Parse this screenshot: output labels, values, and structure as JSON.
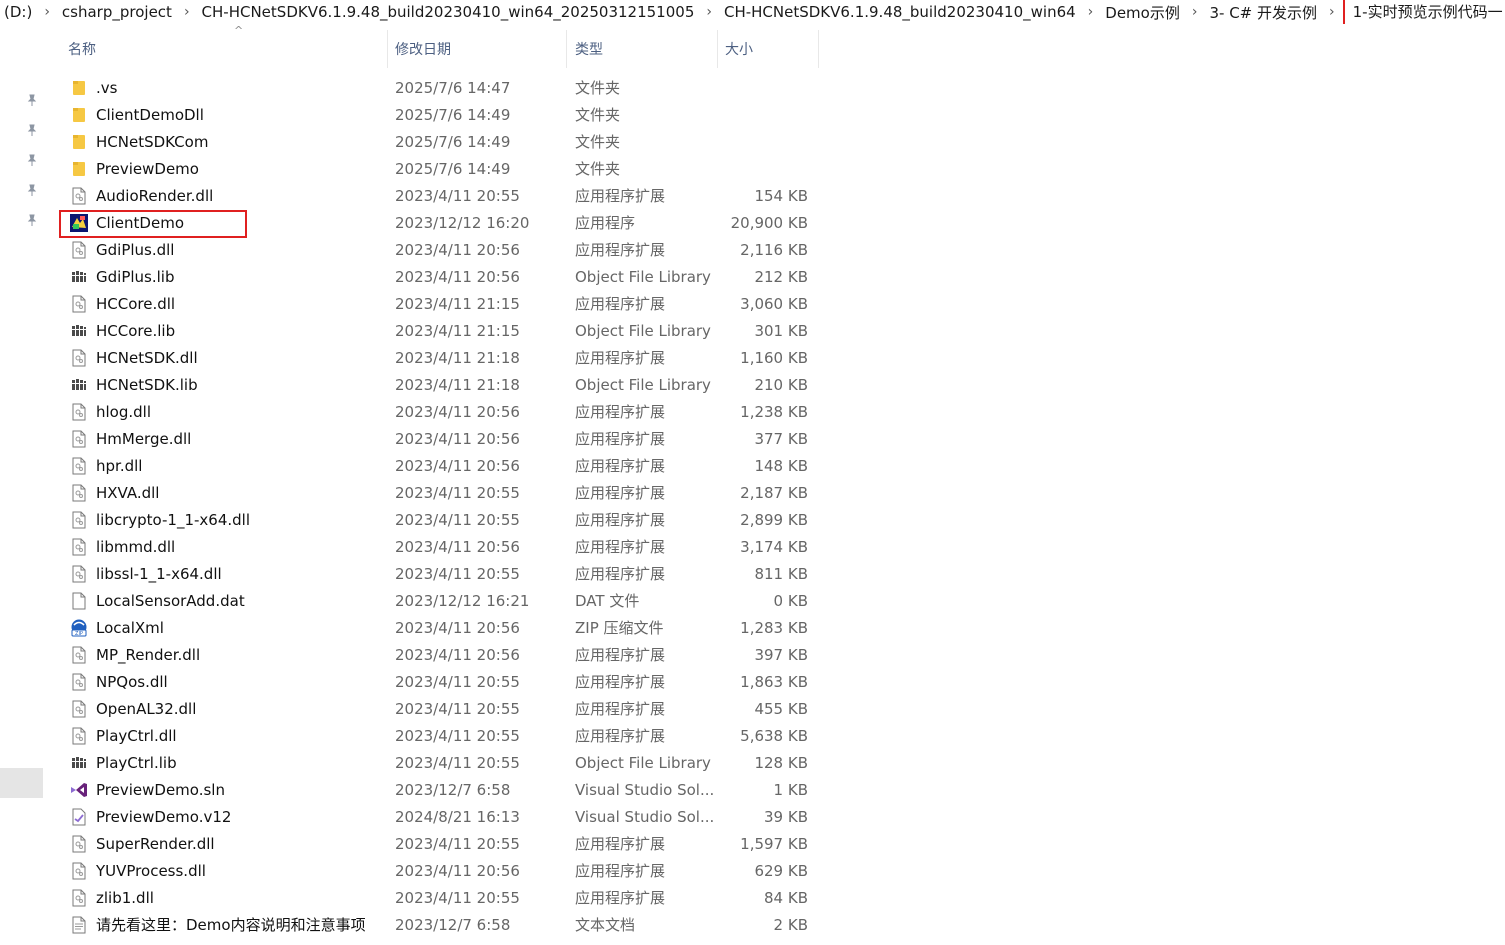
{
  "breadcrumb": {
    "items": [
      "(D:)",
      "csharp_project",
      "CH-HCNetSDKV6.1.9.48_build20230410_win64_20250312151005",
      "CH-HCNetSDKV6.1.9.48_build20230410_win64",
      "Demo示例",
      "3- C# 开发示例",
      "1-实时预览示例代码一"
    ],
    "separator": "›"
  },
  "columns": {
    "name": "名称",
    "date": "修改日期",
    "type": "类型",
    "size": "大小"
  },
  "files": [
    {
      "name": ".vs",
      "date": "2025/7/6 14:47",
      "type": "文件夹",
      "size": "",
      "icon": "folder-icon"
    },
    {
      "name": "ClientDemoDll",
      "date": "2025/7/6 14:49",
      "type": "文件夹",
      "size": "",
      "icon": "folder-icon"
    },
    {
      "name": "HCNetSDKCom",
      "date": "2025/7/6 14:49",
      "type": "文件夹",
      "size": "",
      "icon": "folder-icon"
    },
    {
      "name": "PreviewDemo",
      "date": "2025/7/6 14:49",
      "type": "文件夹",
      "size": "",
      "icon": "folder-icon"
    },
    {
      "name": "AudioRender.dll",
      "date": "2023/4/11 20:55",
      "type": "应用程序扩展",
      "size": "154 KB",
      "icon": "dll-icon"
    },
    {
      "name": "ClientDemo",
      "date": "2023/12/12 16:20",
      "type": "应用程序",
      "size": "20,900 KB",
      "icon": "exe-icon",
      "highlighted": true
    },
    {
      "name": "GdiPlus.dll",
      "date": "2023/4/11 20:56",
      "type": "应用程序扩展",
      "size": "2,116 KB",
      "icon": "dll-icon"
    },
    {
      "name": "GdiPlus.lib",
      "date": "2023/4/11 20:56",
      "type": "Object File Library",
      "size": "212 KB",
      "icon": "lib-icon"
    },
    {
      "name": "HCCore.dll",
      "date": "2023/4/11 21:15",
      "type": "应用程序扩展",
      "size": "3,060 KB",
      "icon": "dll-icon"
    },
    {
      "name": "HCCore.lib",
      "date": "2023/4/11 21:15",
      "type": "Object File Library",
      "size": "301 KB",
      "icon": "lib-icon"
    },
    {
      "name": "HCNetSDK.dll",
      "date": "2023/4/11 21:18",
      "type": "应用程序扩展",
      "size": "1,160 KB",
      "icon": "dll-icon"
    },
    {
      "name": "HCNetSDK.lib",
      "date": "2023/4/11 21:18",
      "type": "Object File Library",
      "size": "210 KB",
      "icon": "lib-icon"
    },
    {
      "name": "hlog.dll",
      "date": "2023/4/11 20:56",
      "type": "应用程序扩展",
      "size": "1,238 KB",
      "icon": "dll-icon"
    },
    {
      "name": "HmMerge.dll",
      "date": "2023/4/11 20:56",
      "type": "应用程序扩展",
      "size": "377 KB",
      "icon": "dll-icon"
    },
    {
      "name": "hpr.dll",
      "date": "2023/4/11 20:56",
      "type": "应用程序扩展",
      "size": "148 KB",
      "icon": "dll-icon"
    },
    {
      "name": "HXVA.dll",
      "date": "2023/4/11 20:55",
      "type": "应用程序扩展",
      "size": "2,187 KB",
      "icon": "dll-icon"
    },
    {
      "name": "libcrypto-1_1-x64.dll",
      "date": "2023/4/11 20:55",
      "type": "应用程序扩展",
      "size": "2,899 KB",
      "icon": "dll-icon"
    },
    {
      "name": "libmmd.dll",
      "date": "2023/4/11 20:56",
      "type": "应用程序扩展",
      "size": "3,174 KB",
      "icon": "dll-icon"
    },
    {
      "name": "libssl-1_1-x64.dll",
      "date": "2023/4/11 20:55",
      "type": "应用程序扩展",
      "size": "811 KB",
      "icon": "dll-icon"
    },
    {
      "name": "LocalSensorAdd.dat",
      "date": "2023/12/12 16:21",
      "type": "DAT 文件",
      "size": "0 KB",
      "icon": "blank-file-icon"
    },
    {
      "name": "LocalXml",
      "date": "2023/4/11 20:56",
      "type": "ZIP 压缩文件",
      "size": "1,283 KB",
      "icon": "zip-icon"
    },
    {
      "name": "MP_Render.dll",
      "date": "2023/4/11 20:56",
      "type": "应用程序扩展",
      "size": "397 KB",
      "icon": "dll-icon"
    },
    {
      "name": "NPQos.dll",
      "date": "2023/4/11 20:55",
      "type": "应用程序扩展",
      "size": "1,863 KB",
      "icon": "dll-icon"
    },
    {
      "name": "OpenAL32.dll",
      "date": "2023/4/11 20:55",
      "type": "应用程序扩展",
      "size": "455 KB",
      "icon": "dll-icon"
    },
    {
      "name": "PlayCtrl.dll",
      "date": "2023/4/11 20:55",
      "type": "应用程序扩展",
      "size": "5,638 KB",
      "icon": "dll-icon"
    },
    {
      "name": "PlayCtrl.lib",
      "date": "2023/4/11 20:55",
      "type": "Object File Library",
      "size": "128 KB",
      "icon": "lib-icon"
    },
    {
      "name": "PreviewDemo.sln",
      "date": "2023/12/7 6:58",
      "type": "Visual Studio Sol...",
      "size": "1 KB",
      "icon": "vs-solution-icon"
    },
    {
      "name": "PreviewDemo.v12",
      "date": "2024/8/21 16:13",
      "type": "Visual Studio Sol...",
      "size": "39 KB",
      "icon": "vs-user-options-icon"
    },
    {
      "name": "SuperRender.dll",
      "date": "2023/4/11 20:55",
      "type": "应用程序扩展",
      "size": "1,597 KB",
      "icon": "dll-icon"
    },
    {
      "name": "YUVProcess.dll",
      "date": "2023/4/11 20:56",
      "type": "应用程序扩展",
      "size": "629 KB",
      "icon": "dll-icon"
    },
    {
      "name": "zlib1.dll",
      "date": "2023/4/11 20:55",
      "type": "应用程序扩展",
      "size": "84 KB",
      "icon": "dll-icon"
    },
    {
      "name": "请先看这里：Demo内容说明和注意事项",
      "date": "2023/12/7 6:58",
      "type": "文本文档",
      "size": "2 KB",
      "icon": "text-file-icon"
    }
  ],
  "colors": {
    "highlight": "#e02020",
    "folder": "#f6c843",
    "header_text": "#4d6082",
    "secondary_text": "#666666"
  }
}
